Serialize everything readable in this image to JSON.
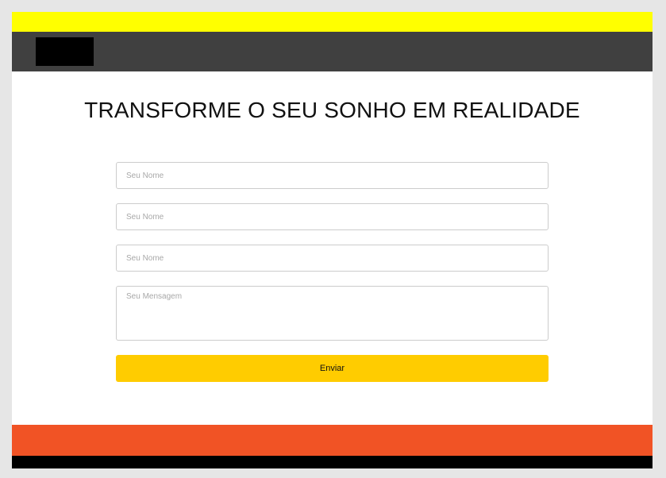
{
  "colors": {
    "topbar": "#ffff00",
    "header": "#404040",
    "button": "#ffcc00",
    "footer_orange": "#f15325",
    "footer_black": "#000000"
  },
  "hero": {
    "title": "TRANSFORME O SEU SONHO EM REALIDADE"
  },
  "form": {
    "field1_placeholder": "Seu Nome",
    "field2_placeholder": "Seu Nome",
    "field3_placeholder": "Seu Nome",
    "message_placeholder": "Seu Mensagem",
    "submit_label": "Enviar"
  }
}
